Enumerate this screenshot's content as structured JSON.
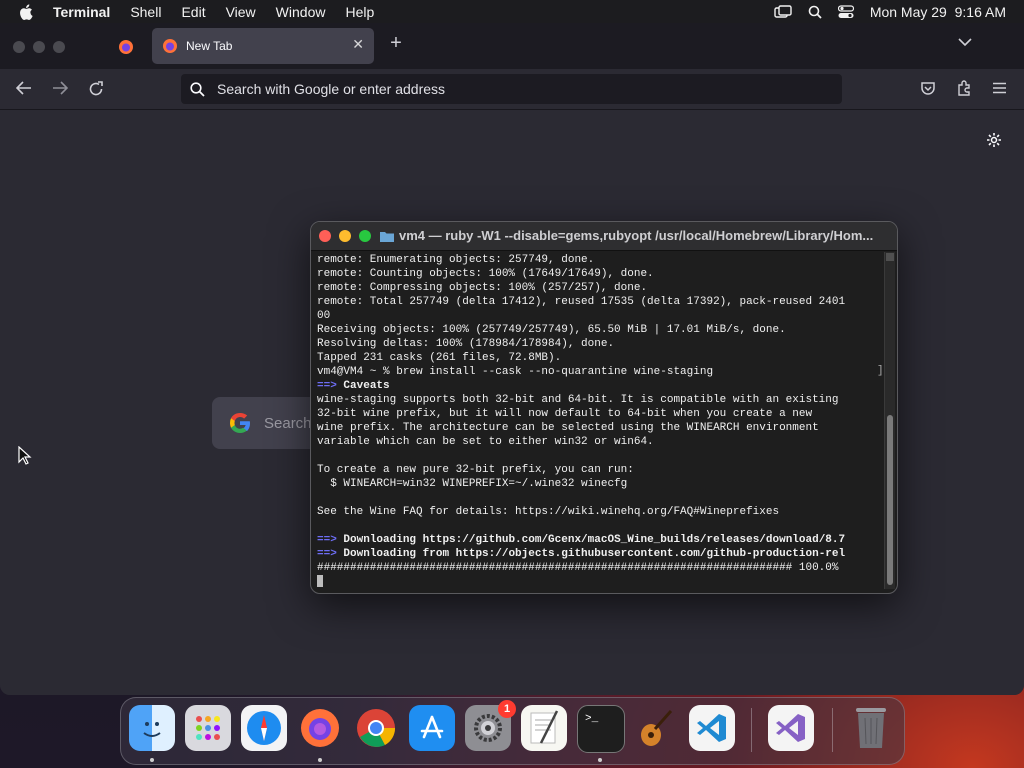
{
  "menubar": {
    "app_name": "Terminal",
    "items": [
      "Shell",
      "Edit",
      "View",
      "Window",
      "Help"
    ],
    "datetime": "Mon May 29  9:16 AM"
  },
  "browser": {
    "active_tab_title": "New Tab",
    "address_placeholder": "Search with Google or enter address",
    "google_search_placeholder": "Search"
  },
  "terminal": {
    "title": "vm4 — ruby -W1 --disable=gems,rubyopt /usr/local/Homebrew/Library/Hom...",
    "lines": [
      "remote: Enumerating objects: 257749, done.",
      "remote: Counting objects: 100% (17649/17649), done.",
      "remote: Compressing objects: 100% (257/257), done.",
      "remote: Total 257749 (delta 17412), reused 17535 (delta 17392), pack-reused 2401",
      "00",
      "Receiving objects: 100% (257749/257749), 65.50 MiB | 17.01 MiB/s, done.",
      "Resolving deltas: 100% (178984/178984), done.",
      "Tapped 231 casks (261 files, 72.8MB).",
      "vm4@VM4 ~ % brew install --cask --no-quarantine wine-staging"
    ],
    "caveats_arrow": "==>",
    "caveats_label": "Caveats",
    "caveat_lines": [
      "wine-staging supports both 32-bit and 64-bit. It is compatible with an existing",
      "32-bit wine prefix, but it will now default to 64-bit when you create a new",
      "wine prefix. The architecture can be selected using the WINEARCH environment",
      "variable which can be set to either win32 or win64.",
      "",
      "To create a new pure 32-bit prefix, you can run:",
      "  $ WINEARCH=win32 WINEPREFIX=~/.wine32 winecfg",
      "",
      "See the Wine FAQ for details: https://wiki.winehq.org/FAQ#Wineprefixes",
      ""
    ],
    "download_lines": [
      "Downloading https://github.com/Gcenx/macOS_Wine_builds/releases/download/8.7",
      "Downloading from https://objects.githubusercontent.com/github-production-rel"
    ],
    "progress_line": "######################################################################## 100.0%"
  },
  "dock": {
    "items": [
      "Finder",
      "Launchpad",
      "Safari",
      "Firefox",
      "Google Chrome",
      "App Store",
      "System Preferences",
      "TextEdit",
      "Terminal",
      "GarageBand",
      "Visual Studio Code",
      "Visual Studio",
      "Trash"
    ],
    "system_preferences_badge": "1"
  },
  "colors": {
    "terminal_arrow": "#6e6ef5",
    "close": "#ff5f57",
    "minimize": "#febc2e",
    "zoom": "#28c840"
  }
}
